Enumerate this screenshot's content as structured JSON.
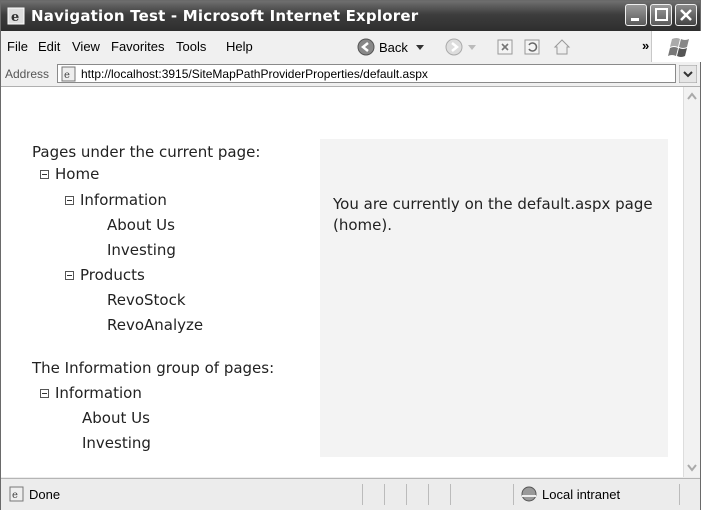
{
  "window": {
    "title": "Navigation Test - Microsoft Internet Explorer"
  },
  "menu": {
    "file": "File",
    "edit": "Edit",
    "view": "View",
    "favorites": "Favorites",
    "tools": "Tools",
    "help": "Help"
  },
  "toolbar": {
    "back_label": "Back",
    "more": "»"
  },
  "address": {
    "label": "Address",
    "url": "http://localhost:3915/SiteMapPathProviderProperties/default.aspx"
  },
  "tree1": {
    "heading": "Pages under the current page:",
    "root": "Home",
    "group1": "Information",
    "group1_items": [
      "About Us",
      "Investing"
    ],
    "group2": "Products",
    "group2_items": [
      "RevoStock",
      "RevoAnalyze"
    ]
  },
  "tree2": {
    "heading": "The Information group of pages:",
    "root": "Information",
    "items": [
      "About Us",
      "Investing"
    ]
  },
  "panel": {
    "text": "You are currently on the default.aspx page (home)."
  },
  "status": {
    "text": "Done",
    "zone": "Local intranet"
  }
}
